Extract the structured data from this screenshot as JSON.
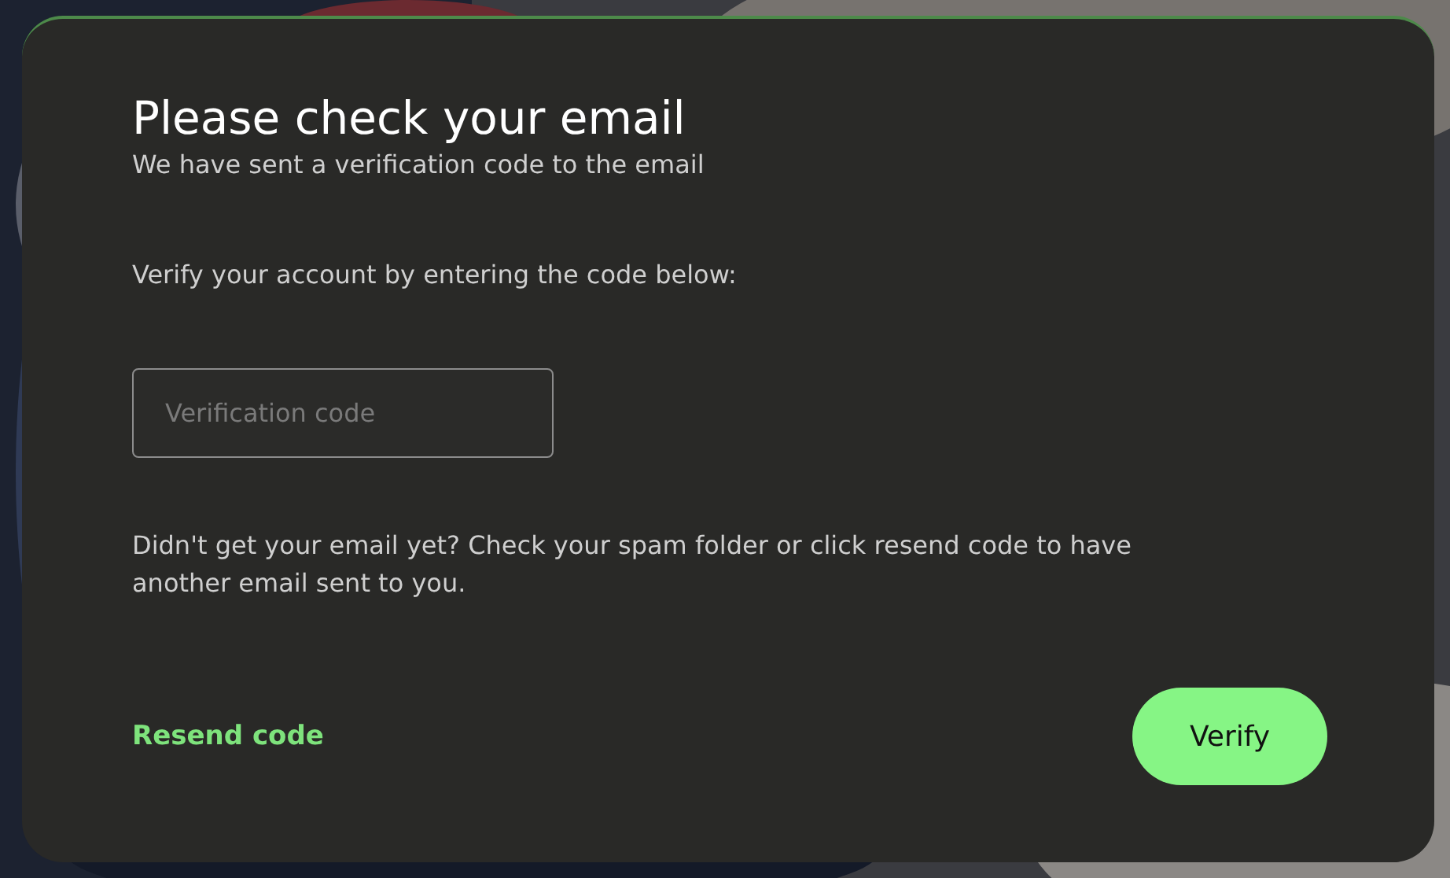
{
  "dialog": {
    "title": "Please check your email",
    "subtitle": "We have sent a verification code to the email",
    "instruction": "Verify your account by entering the code below:",
    "code_field": {
      "placeholder": "Verification code"
    },
    "help_text": "Didn't get your email yet? Check your spam folder or click resend code to have another email sent to you.",
    "resend_link": "Resend code",
    "verify_button": "Verify"
  }
}
